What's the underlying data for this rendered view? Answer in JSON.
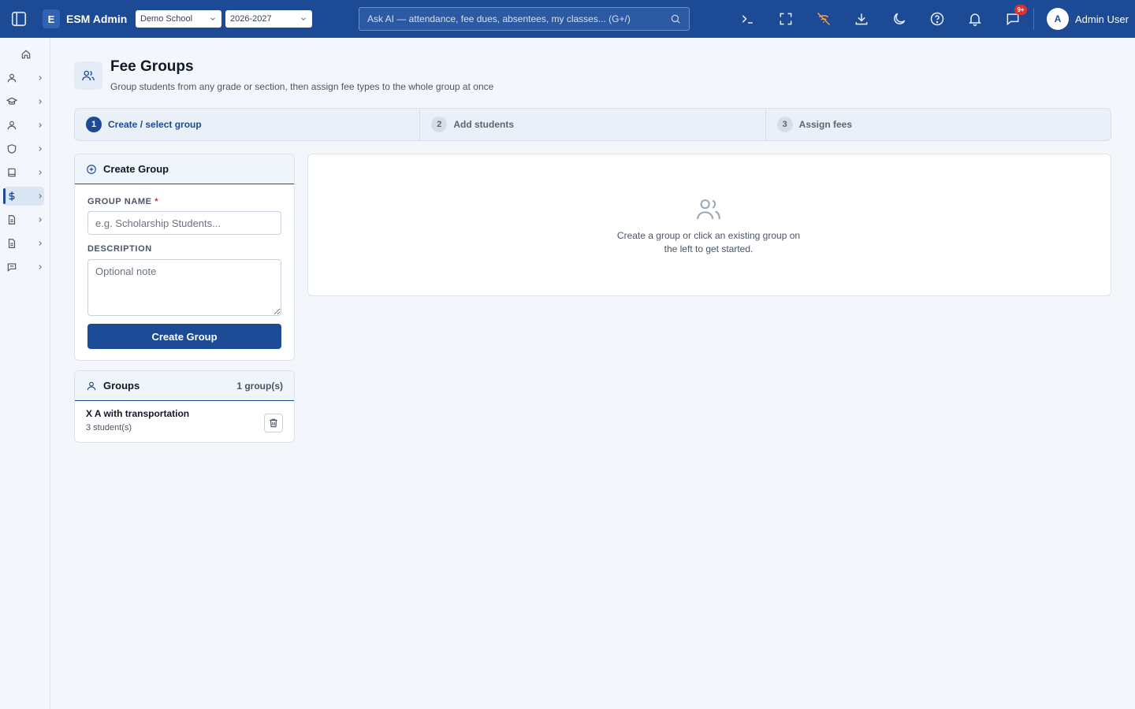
{
  "topbar": {
    "brand_letter": "E",
    "brand_name": "ESM Admin",
    "school_select": "Demo School",
    "year_select": "2026-2027",
    "search_placeholder": "Ask AI — attendance, fee dues, absentees, my classes... (G+/)",
    "notification_badge": "9+",
    "avatar_letter": "A",
    "user_name": "Admin User",
    "accent_color": "#1c4a94"
  },
  "sidebar": {
    "icons": [
      "home-icon",
      "user-icon",
      "graduation-cap-icon",
      "user-icon",
      "shield-icon",
      "book-icon",
      "dollar-icon",
      "document-icon",
      "document-icon",
      "message-icon"
    ],
    "active_icon": "dollar-icon"
  },
  "header": {
    "title": "Fee Groups",
    "subtitle": "Group students from any grade or section, then assign fee types to the whole group at once"
  },
  "steps": [
    {
      "num": "1",
      "label": "Create / select group"
    },
    {
      "num": "2",
      "label": "Add students"
    },
    {
      "num": "3",
      "label": "Assign fees"
    }
  ],
  "create_panel": {
    "title": "Create Group",
    "name_label": "GROUP NAME",
    "name_required": "*",
    "name_placeholder": "e.g. Scholarship Students...",
    "description_label": "DESCRIPTION",
    "description_placeholder": "Optional note",
    "submit_label": "Create Group"
  },
  "groups_panel": {
    "title": "Groups",
    "count": "1 group(s)",
    "items": [
      {
        "name": "X A with transportation",
        "students": "3 student(s)"
      }
    ]
  },
  "empty_state": {
    "line1": "Create a group or click an existing group on",
    "line2": "the left to get started."
  }
}
